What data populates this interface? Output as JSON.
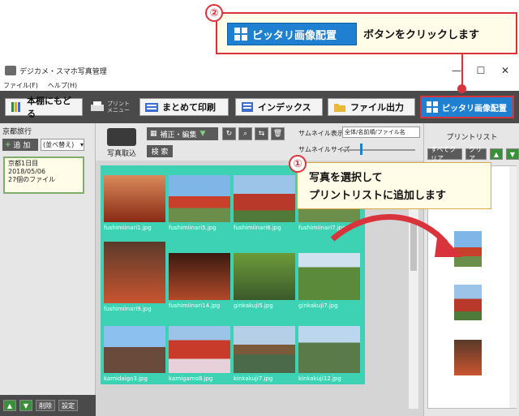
{
  "callout2": {
    "number": "②",
    "button_label": "ピッタリ画像配置",
    "text": "ボタンをクリックします"
  },
  "window": {
    "title": "デジカメ・スマホ写真管理",
    "menu": [
      "ファイル(F)",
      "ヘルプ(H)"
    ],
    "controls": [
      "—",
      "☐",
      "✕"
    ]
  },
  "toolbar": {
    "back_label": "本棚にもどる",
    "print_menu_label": "プリント\nメニュー",
    "batch_print_label": "まとめて印刷",
    "index_label": "インデックス",
    "file_output_label": "ファイル出力",
    "fit_layout_label": "ピッタリ画像配置"
  },
  "left_panel": {
    "title": "京都旅行",
    "add_label": "追 加",
    "sort_label": "(並べ替え)",
    "album_lines": [
      "京都1日目",
      "2018/05/06",
      "27個のファイル"
    ],
    "bottom_buttons": [
      "▲",
      "▼",
      "削除",
      "設定"
    ]
  },
  "center": {
    "photo_import_label": "写真取込",
    "edit_label": "補正・編集",
    "search_label": "検 索",
    "thumb_display_label": "サムネイル表示",
    "thumb_display_value": "全体/名前順/ファイル名",
    "thumb_size_label": "サムネイルサイズ",
    "thumbnails": [
      "fushimiinari1.jpg",
      "fushimiinari5.jpg",
      "fushimiinari6.jpg",
      "fushimiinari7.jpg",
      "fushimiinari9.jpg",
      "fushimiinari14.jpg",
      "ginkakuji5.jpg",
      "ginkakuji7.jpg",
      "kamidaigo3.jpg",
      "kamigamo8.jpg",
      "kinkakuji7.jpg",
      "kinkakuji12.jpg"
    ]
  },
  "callout1": {
    "number": "①",
    "line1": "写真を選択して",
    "line2": "プリントリストに追加します"
  },
  "right_panel": {
    "title": "プリントリスト",
    "clear_all_label": "すべてクリア",
    "clear_label": "クリア"
  }
}
